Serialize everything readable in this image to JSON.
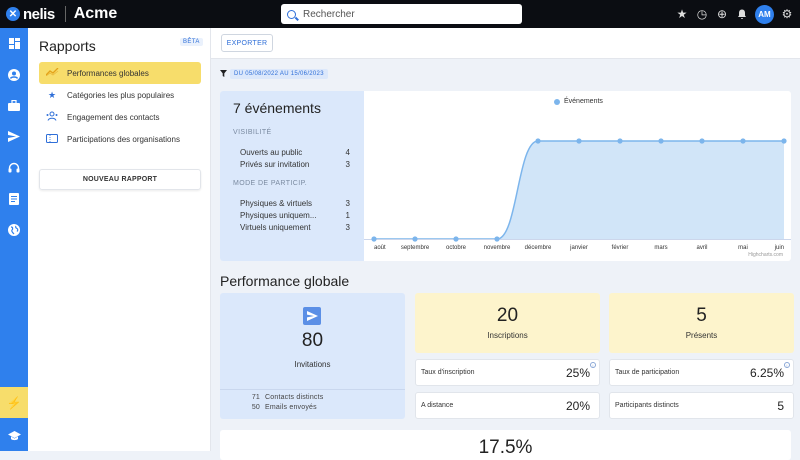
{
  "topbar": {
    "logo_text": "nelis",
    "org_name": "Acme",
    "search_placeholder": "Rechercher",
    "avatar_initials": "AM"
  },
  "sidebar": {
    "title": "Rapports",
    "badge": "BÊTA",
    "items": [
      {
        "label": "Performances globales",
        "icon": "trend-icon",
        "active": true
      },
      {
        "label": "Catégories les plus populaires",
        "icon": "star-icon",
        "active": false
      },
      {
        "label": "Engagement des contacts",
        "icon": "contacts-icon",
        "active": false
      },
      {
        "label": "Participations des organisations",
        "icon": "ticket-icon",
        "active": false
      }
    ],
    "new_report_label": "NOUVEAU RAPPORT"
  },
  "toolbar": {
    "export_label": "EXPORTER",
    "filter_label": "DU 05/08/2022 AU 15/06/2023"
  },
  "events": {
    "count_label": "7 événements",
    "visibility_heading": "VISIBILITÉ",
    "visibility": [
      {
        "label": "Ouverts au public",
        "value": "4"
      },
      {
        "label": "Privés sur invitation",
        "value": "3"
      }
    ],
    "mode_heading": "MODE DE PARTICIP.",
    "modes": [
      {
        "label": "Physiques & virtuels",
        "value": "3"
      },
      {
        "label": "Physiques uniquem...",
        "value": "1"
      },
      {
        "label": "Virtuels uniquement",
        "value": "3"
      }
    ]
  },
  "chart_data": {
    "type": "area",
    "title": "",
    "xlabel": "",
    "ylabel": "",
    "categories": [
      "août",
      "septembre",
      "octobre",
      "novembre",
      "décembre",
      "janvier",
      "février",
      "mars",
      "avril",
      "mai",
      "juin"
    ],
    "series": [
      {
        "name": "Événements",
        "values": [
          0,
          0,
          0,
          0,
          7,
          7,
          7,
          7,
          7,
          7,
          7
        ]
      }
    ],
    "ylim": [
      0,
      7
    ],
    "grid": false,
    "legend": "top",
    "credits": "Highcharts.com",
    "color": "#7cb5ec"
  },
  "performance": {
    "title": "Performance globale",
    "invitations": {
      "value": "80",
      "label": "Invitations",
      "distinct_contacts_count": "71",
      "distinct_contacts_label": "Contacts distincts",
      "emails_sent_count": "50",
      "emails_sent_label": "Emails envoyés"
    },
    "inscriptions": {
      "value": "20",
      "label": "Inscriptions"
    },
    "presents": {
      "value": "5",
      "label": "Présents"
    },
    "taux_inscription": {
      "label": "Taux d'inscription",
      "value": "25%"
    },
    "taux_participation": {
      "label": "Taux de participation",
      "value": "6.25%"
    },
    "a_distance": {
      "label": "A distance",
      "value": "20%"
    },
    "participants_distincts": {
      "label": "Participants distincts",
      "value": "5"
    },
    "bottom_value": "17.5%"
  },
  "colors": {
    "brand": "#2f80ed",
    "active": "#f7dd6b",
    "blue_card": "#dbe8fb",
    "yellow_card": "#fdf4cc"
  }
}
